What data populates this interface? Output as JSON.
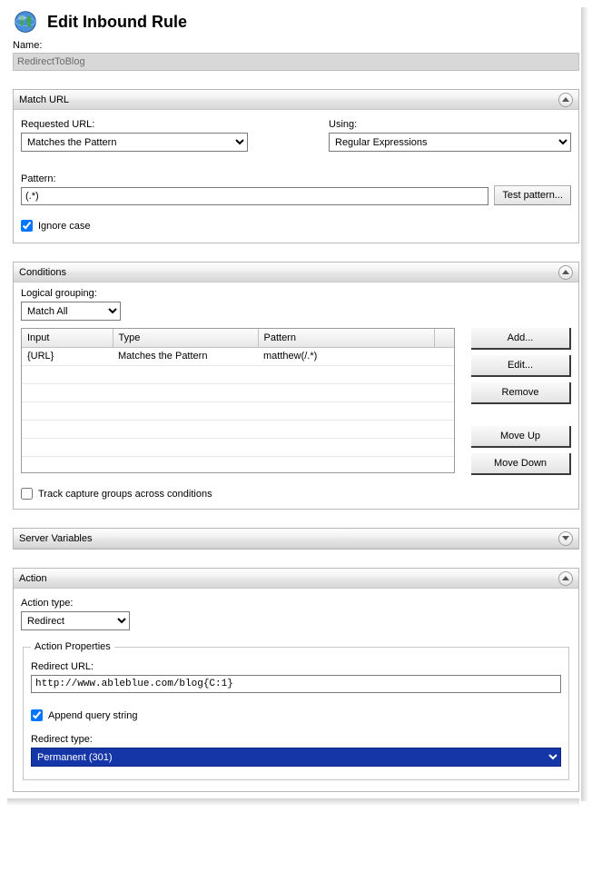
{
  "header": {
    "title": "Edit Inbound Rule"
  },
  "name": {
    "label": "Name:",
    "value": "RedirectToBlog"
  },
  "match": {
    "section_title": "Match URL",
    "requested_url_label": "Requested URL:",
    "requested_url_value": "Matches the Pattern",
    "using_label": "Using:",
    "using_value": "Regular Expressions",
    "pattern_label": "Pattern:",
    "pattern_value": "(.*)",
    "test_button": "Test pattern...",
    "ignore_case_label": "Ignore case"
  },
  "conditions": {
    "section_title": "Conditions",
    "grouping_label": "Logical grouping:",
    "grouping_value": "Match All",
    "columns": {
      "input": "Input",
      "type": "Type",
      "pattern": "Pattern"
    },
    "rows": [
      {
        "input": "{URL}",
        "type": "Matches the Pattern",
        "pattern": "matthew(/.*)"
      }
    ],
    "buttons": {
      "add": "Add...",
      "edit": "Edit...",
      "remove": "Remove",
      "move_up": "Move Up",
      "move_down": "Move Down"
    },
    "track_groups_label": "Track capture groups across conditions"
  },
  "server_vars": {
    "section_title": "Server Variables"
  },
  "action": {
    "section_title": "Action",
    "type_label": "Action type:",
    "type_value": "Redirect",
    "properties_legend": "Action Properties",
    "redirect_url_label": "Redirect URL:",
    "redirect_url_value": "http://www.ableblue.com/blog{C:1}",
    "append_label": "Append query string",
    "redirect_type_label": "Redirect type:",
    "redirect_type_value": "Permanent (301)"
  }
}
